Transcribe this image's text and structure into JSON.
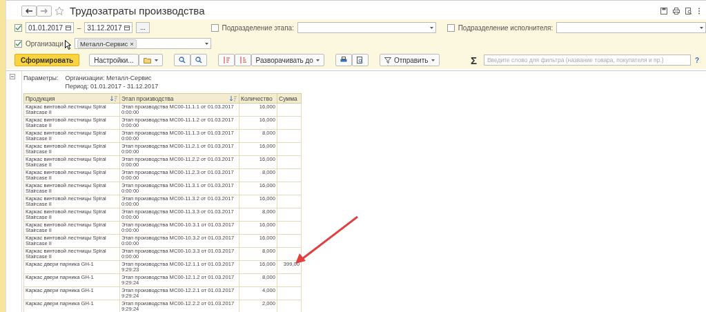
{
  "window": {
    "title": "Трудозатраты производства"
  },
  "filters": {
    "period": {
      "checked": true,
      "from": "01.01.2017",
      "separator": "–",
      "to": "31.12.2017",
      "more": "..."
    },
    "stage_division": {
      "checked": false,
      "label": "Подразделение этапа:"
    },
    "executor_division": {
      "checked": false,
      "label": "Подразделение исполнителя:"
    },
    "organization": {
      "checked": true,
      "label": "Организаци",
      "tag": "Металл-Сервис",
      "tag_close": "×"
    }
  },
  "toolbar": {
    "generate": "Сформировать",
    "settings": "Настройки...",
    "expand": "Разворачивать до",
    "send": "Отправить",
    "sum_symbol": "Σ",
    "search": {
      "placeholder": "Введите слово для фильтра (название товара, покупателя и пр.)"
    },
    "help": "?"
  },
  "report": {
    "params_label": "Параметры:",
    "params": [
      "Организации: Металл-Сервис",
      "Период: 01.01.2017 - 31.12.2017"
    ],
    "table": {
      "columns": [
        "Продукция",
        "Этап производства",
        "Количество",
        "Сумма"
      ],
      "rows": [
        [
          "Каркас винтовой лестницы Spiral Staircase II",
          "Этап производства МС00-11.1.1 от 01.03.2017 0:00:00",
          "16,000",
          ""
        ],
        [
          "Каркас винтовой лестницы Spiral Staircase II",
          "Этап производства МС00-11.1.2 от 01.03.2017 0:00:00",
          "16,000",
          ""
        ],
        [
          "Каркас винтовой лестницы Spiral Staircase II",
          "Этап производства МС00-11.1.3 от 01.03.2017 0:00:00",
          "8,000",
          ""
        ],
        [
          "Каркас винтовой лестницы Spiral Staircase II",
          "Этап производства МС00-11.2.1 от 01.03.2017 0:00:00",
          "16,000",
          ""
        ],
        [
          "Каркас винтовой лестницы Spiral Staircase II",
          "Этап производства МС00-11.2.2 от 01.03.2017 0:00:00",
          "16,000",
          ""
        ],
        [
          "Каркас винтовой лестницы Spiral Staircase II",
          "Этап производства МС00-11.2.3 от 01.03.2017 0:00:00",
          "8,000",
          ""
        ],
        [
          "Каркас винтовой лестницы Spiral Staircase II",
          "Этап производства МС00-11.3.1 от 01.03.2017 0:00:00",
          "16,000",
          ""
        ],
        [
          "Каркас винтовой лестницы Spiral Staircase II",
          "Этап производства МС00-11.3.2 от 01.03.2017 0:00:00",
          "16,000",
          ""
        ],
        [
          "Каркас винтовой лестницы Spiral Staircase II",
          "Этап производства МС00-11.3.3 от 01.03.2017 0:00:00",
          "8,000",
          ""
        ],
        [
          "Каркас винтовой лестницы Spiral Staircase II",
          "Этап производства МС00-10.3.1 от 01.03.2017 0:00:00",
          "16,000",
          ""
        ],
        [
          "Каркас винтовой лестницы Spiral Staircase II",
          "Этап производства МС00-10.3.2 от 01.03.2017 0:00:00",
          "16,000",
          ""
        ],
        [
          "Каркас винтовой лестницы Spiral Staircase II",
          "Этап производства МС00-10.3.3 от 01.03.2017 0:00:00",
          "8,000",
          ""
        ],
        [
          "Каркас двери парника GH-1",
          "Этап производства МС00-12.1.1 от 01.03.2017 9:29:23",
          "16,000",
          "399,00"
        ],
        [
          "Каркас двери парника GH-1",
          "Этап производства МС00-12.1.2 от 01.03.2017 9:29:24",
          "8,000",
          ""
        ],
        [
          "Каркас двери парника GH-1",
          "Этап производства МС00-12.2.1 от 01.03.2017 9:29:24",
          "4,000",
          ""
        ],
        [
          "Каркас двери парника GH-1",
          "Этап производства МС00-12.2.2 от 01.03.2017 9:29:24",
          "2,000",
          ""
        ]
      ]
    }
  }
}
